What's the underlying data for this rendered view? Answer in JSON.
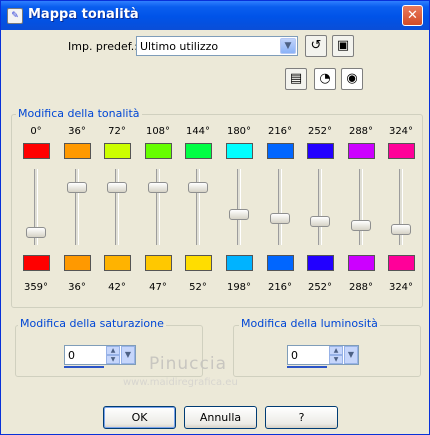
{
  "window": {
    "title": "Mappa tonalità"
  },
  "preset": {
    "label": "Imp. predef.:",
    "value": "Ultimo utilizzo"
  },
  "hue": {
    "title": "Modifica della tonalità",
    "channels": [
      {
        "from": "0°",
        "to": "359°",
        "from_color": "#ff0000",
        "to_color": "#ff0000",
        "level": 0.11
      },
      {
        "from": "36°",
        "to": "36°",
        "from_color": "#ff9900",
        "to_color": "#ff9900",
        "level": 0.8
      },
      {
        "from": "72°",
        "to": "42°",
        "from_color": "#ccff00",
        "to_color": "#ffb300",
        "level": 0.8
      },
      {
        "from": "108°",
        "to": "47°",
        "from_color": "#66ff00",
        "to_color": "#ffc800",
        "level": 0.8
      },
      {
        "from": "144°",
        "to": "52°",
        "from_color": "#00ff44",
        "to_color": "#ffdd00",
        "level": 0.8
      },
      {
        "from": "180°",
        "to": "198°",
        "from_color": "#00ffff",
        "to_color": "#00b3ff",
        "level": 0.38
      },
      {
        "from": "216°",
        "to": "216°",
        "from_color": "#0066ff",
        "to_color": "#0066ff",
        "level": 0.33
      },
      {
        "from": "252°",
        "to": "252°",
        "from_color": "#2200ff",
        "to_color": "#2200ff",
        "level": 0.27
      },
      {
        "from": "288°",
        "to": "288°",
        "from_color": "#cc00ff",
        "to_color": "#cc00ff",
        "level": 0.21
      },
      {
        "from": "324°",
        "to": "324°",
        "from_color": "#ff0099",
        "to_color": "#ff0099",
        "level": 0.16
      }
    ]
  },
  "saturation": {
    "title": "Modifica della saturazione",
    "value": "0"
  },
  "luminosity": {
    "title": "Modifica della luminosità",
    "value": "0"
  },
  "watermark": {
    "line1": "Pinuccia",
    "line2": "www.maidiregrafica.eu"
  },
  "buttons": {
    "ok": "OK",
    "cancel": "Annulla",
    "help": "?"
  },
  "icons": {
    "title": "app-icon",
    "close": "close-icon",
    "reset": "reset-icon",
    "save": "save-preset-icon",
    "preview": "preview-window-icon",
    "eye_auto": "auto-proof-eye-icon",
    "eye": "proof-eye-icon"
  }
}
